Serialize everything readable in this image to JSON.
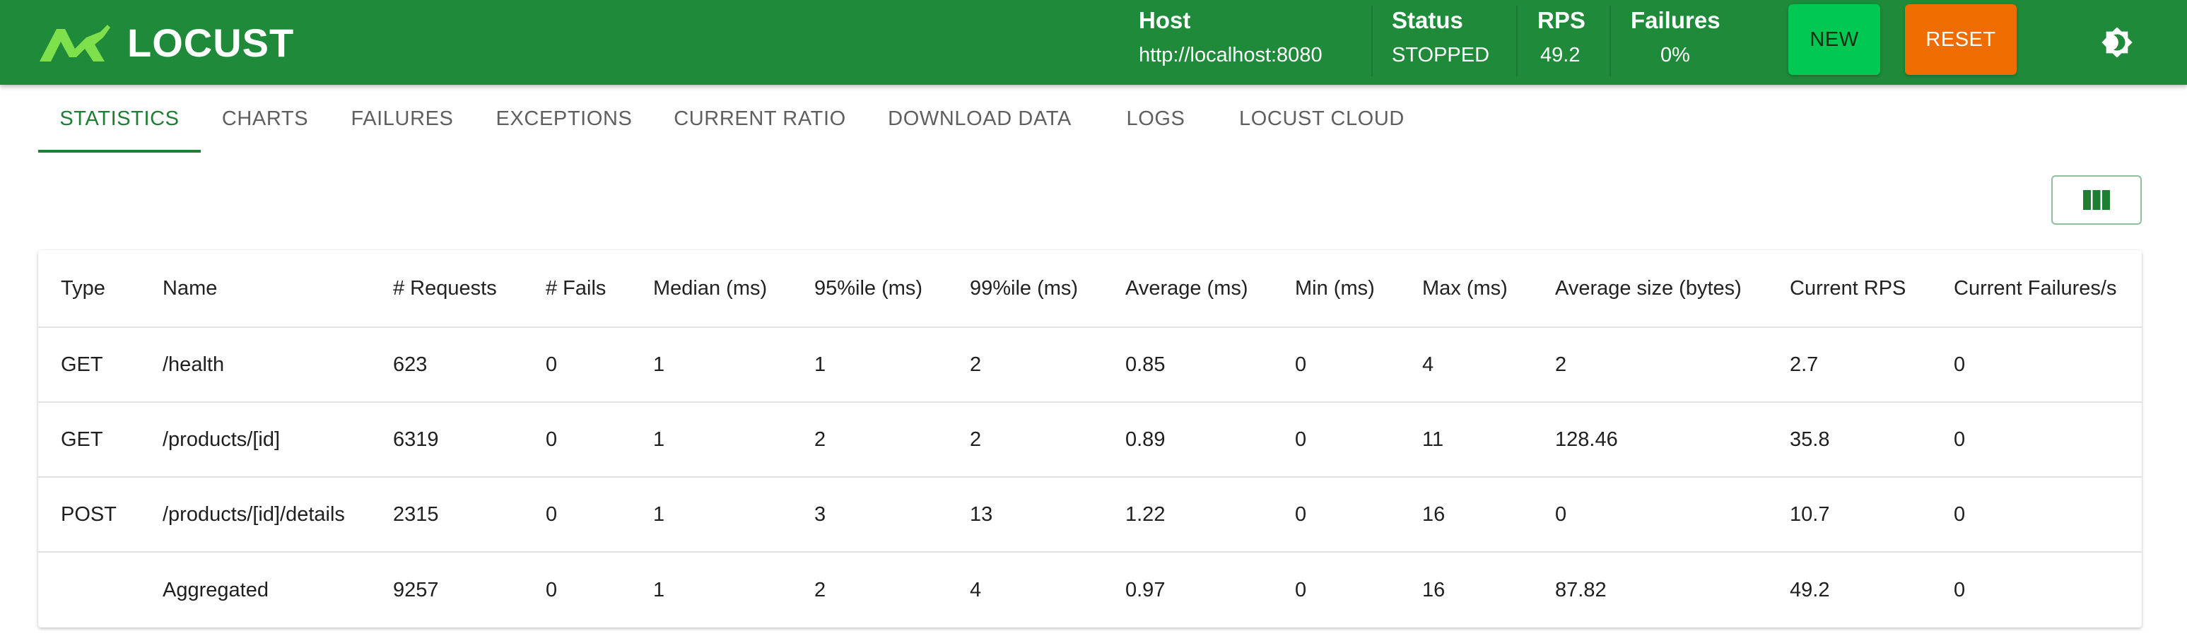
{
  "header": {
    "logo_text": "LOCUST",
    "host": {
      "label": "Host",
      "value": "http://localhost:8080"
    },
    "status": {
      "label": "Status",
      "value": "STOPPED"
    },
    "rps": {
      "label": "RPS",
      "value": "49.2"
    },
    "failures": {
      "label": "Failures",
      "value": "0%"
    },
    "new_label": "NEW",
    "reset_label": "RESET",
    "theme_icon": "brightness-icon",
    "colors": {
      "bar": "#1e8a3a",
      "new": "#00c853",
      "reset": "#ef6c00"
    }
  },
  "tabs": [
    {
      "label": "STATISTICS",
      "active": true
    },
    {
      "label": "CHARTS",
      "active": false
    },
    {
      "label": "FAILURES",
      "active": false
    },
    {
      "label": "EXCEPTIONS",
      "active": false
    },
    {
      "label": "CURRENT RATIO",
      "active": false
    },
    {
      "label": "DOWNLOAD DATA",
      "active": false
    },
    {
      "label": "LOGS",
      "active": false
    },
    {
      "label": "LOCUST CLOUD",
      "active": false
    }
  ],
  "column_toggle_icon": "view-columns-icon",
  "table": {
    "columns": [
      "Type",
      "Name",
      "# Requests",
      "# Fails",
      "Median (ms)",
      "95%ile (ms)",
      "99%ile (ms)",
      "Average (ms)",
      "Min (ms)",
      "Max (ms)",
      "Average size (bytes)",
      "Current RPS",
      "Current Failures/s"
    ],
    "rows": [
      [
        "GET",
        "/health",
        "623",
        "0",
        "1",
        "1",
        "2",
        "0.85",
        "0",
        "4",
        "2",
        "2.7",
        "0"
      ],
      [
        "GET",
        "/products/[id]",
        "6319",
        "0",
        "1",
        "2",
        "2",
        "0.89",
        "0",
        "11",
        "128.46",
        "35.8",
        "0"
      ],
      [
        "POST",
        "/products/[id]/details",
        "2315",
        "0",
        "1",
        "3",
        "13",
        "1.22",
        "0",
        "16",
        "0",
        "10.7",
        "0"
      ],
      [
        "",
        "Aggregated",
        "9257",
        "0",
        "1",
        "2",
        "4",
        "0.97",
        "0",
        "16",
        "87.82",
        "49.2",
        "0"
      ]
    ]
  }
}
